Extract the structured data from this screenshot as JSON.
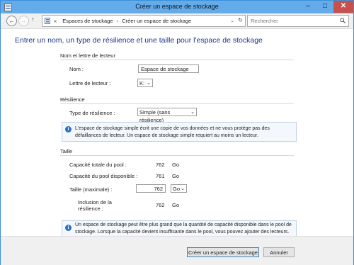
{
  "window": {
    "title": "Créer un espace de stockage",
    "minimize_glyph": "–",
    "maximize_glyph": "□",
    "close_glyph": "✕"
  },
  "nav": {
    "back_glyph": "←",
    "forward_glyph": "→",
    "up_glyph": "↑",
    "prefix": "«",
    "breadcrumb": [
      "Espaces de stockage",
      "Créer un espace de stockage"
    ],
    "separator": "›",
    "dropdown_glyph": "⌄",
    "refresh_glyph": "↻",
    "search_placeholder": "Rechercher"
  },
  "main": {
    "heading": "Entrer un nom, un type de résilience et une taille pour l'espace de stockage",
    "name_section": {
      "title": "Nom et lettre de lecteur",
      "name_label": "Nom :",
      "name_value": "Espace de stockage",
      "letter_label": "Lettre de lecteur :",
      "letter_value": "K:"
    },
    "resilience_section": {
      "title": "Résilience",
      "type_label": "Type de résilience :",
      "type_value": "Simple (sans résilience)",
      "info": "L'espace de stockage simple écrit une copie de vos données et ne vous protège pas des défaillances de lecteur. Un espace de stockage simple requiert au moins un lecteur."
    },
    "size_section": {
      "title": "Taille",
      "total_label": "Capacité totale du pool :",
      "total_value": "762",
      "total_unit": "Go",
      "available_label": "Capacité du pool disponible :",
      "available_value": "761",
      "available_unit": "Go",
      "size_label": "Taille (maximale) :",
      "size_value": "762",
      "size_unit": "Go",
      "resilience_incl_label": "Inclusion de la résilience :",
      "resilience_incl_value": "762",
      "resilience_incl_unit": "Go",
      "info": "Un espace de stockage peut être plus grand que la quantité de capacité disponible dans le pool de stockage. Lorsque la capacité devient insuffisante dans le pool, vous pouvez ajouter des lecteurs."
    }
  },
  "footer": {
    "create_label": "Créer un espace de stockage",
    "cancel_label": "Annuler"
  },
  "icons": {
    "info": "i",
    "chevron": "⌄"
  },
  "colors": {
    "chrome": "#64abea",
    "heading": "#1e3287",
    "info_icon": "#2a6fca",
    "close_button": "#c7504a"
  }
}
